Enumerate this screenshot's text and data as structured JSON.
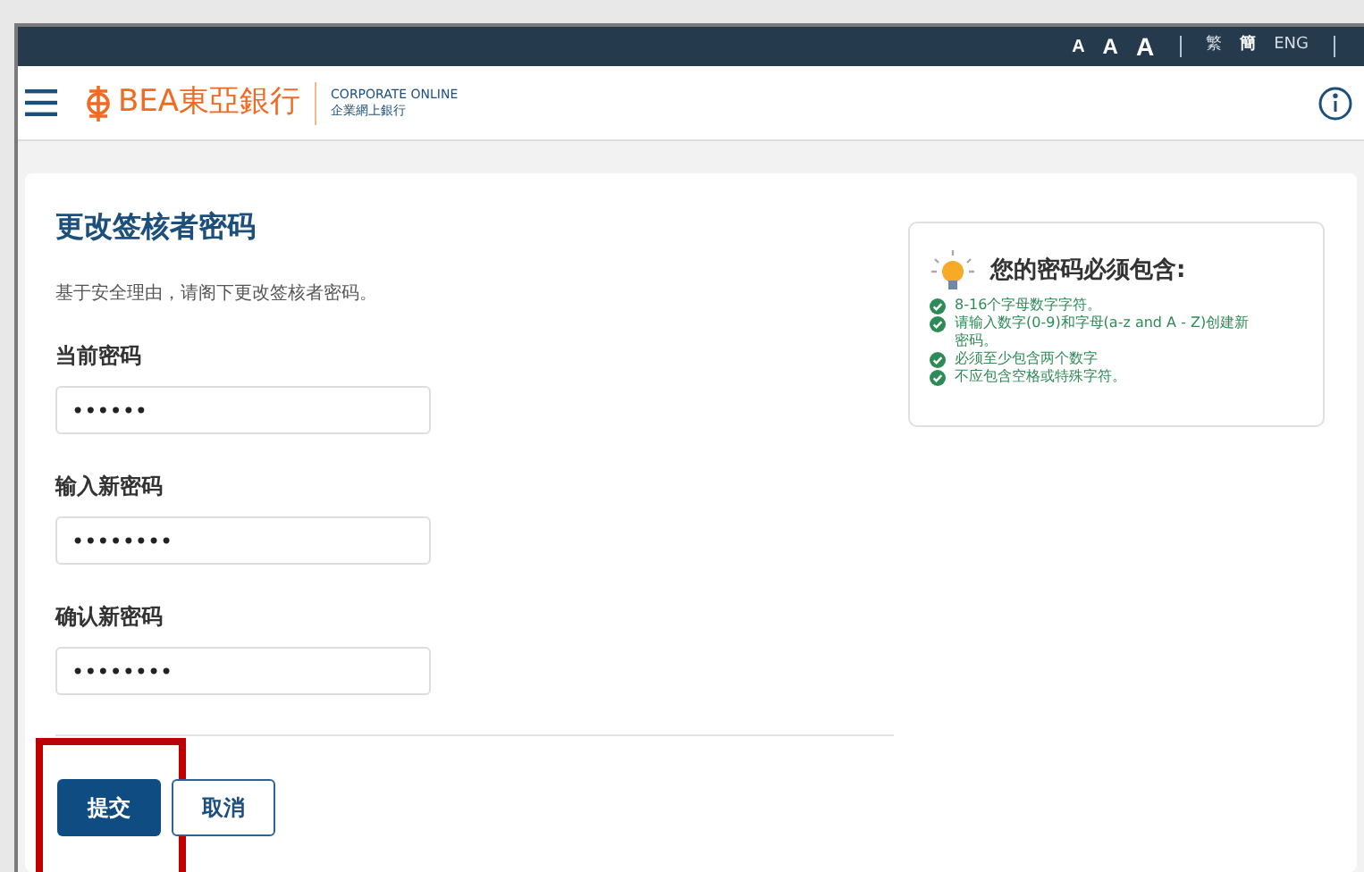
{
  "top_bar": {
    "font_sizes": [
      "A",
      "A",
      "A"
    ],
    "languages": [
      {
        "label": "繁",
        "selected": false
      },
      {
        "label": "簡",
        "selected": true
      },
      {
        "label": "ENG",
        "selected": false
      }
    ]
  },
  "header": {
    "brand": "BEA東亞銀行",
    "product_en": "CORPORATE ONLINE",
    "product_zh": "企業網上銀行"
  },
  "form": {
    "title": "更改签核者密码",
    "intro": "基于安全理由，请阁下更改签核者密码。",
    "fields": [
      {
        "label": "当前密码",
        "value": "••••••"
      },
      {
        "label": "输入新密码",
        "value": "••••••••"
      },
      {
        "label": "确认新密码",
        "value": "••••••••"
      }
    ],
    "buttons": [
      {
        "label": "提交",
        "kind": "primary",
        "highlighted": true
      },
      {
        "label": "取消",
        "kind": "secondary",
        "highlighted": false
      }
    ]
  },
  "rules": {
    "title": "您的密码必须包含:",
    "items": [
      "8-16个字母数字字符。",
      "请输入数字(0-9)和字母(a-z and A - Z)创建新密码。",
      "必须至少包含两个数字",
      "不应包含空格或特殊字符。"
    ]
  }
}
